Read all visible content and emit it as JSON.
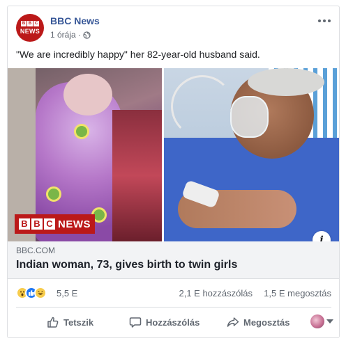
{
  "post": {
    "page_name": "BBC News",
    "timestamp": "1 órája",
    "separator": "·",
    "avatar": {
      "blocks": [
        "B",
        "B",
        "C"
      ],
      "word": "NEWS"
    },
    "caption": "\"We are incredibly happy\" her 82-year-old husband said.",
    "media_logo": {
      "blocks": [
        "B",
        "B",
        "C"
      ],
      "word": "NEWS"
    },
    "info_label": "i",
    "link": {
      "domain": "BBC.COM",
      "title": "Indian woman, 73, gives birth to twin girls"
    }
  },
  "stats": {
    "reaction_icons": [
      "wow-icon",
      "like-icon",
      "haha-icon"
    ],
    "reactions": "5,5 E",
    "comments": "2,1 E hozzászólás",
    "shares": "1,5 E megosztás"
  },
  "actions": {
    "like": "Tetszik",
    "comment": "Hozzászólás",
    "share": "Megosztás"
  },
  "colors": {
    "brand_red": "#bb1919",
    "link_blue": "#385898",
    "like_blue": "#2078f4",
    "secondary_text": "#606770"
  }
}
